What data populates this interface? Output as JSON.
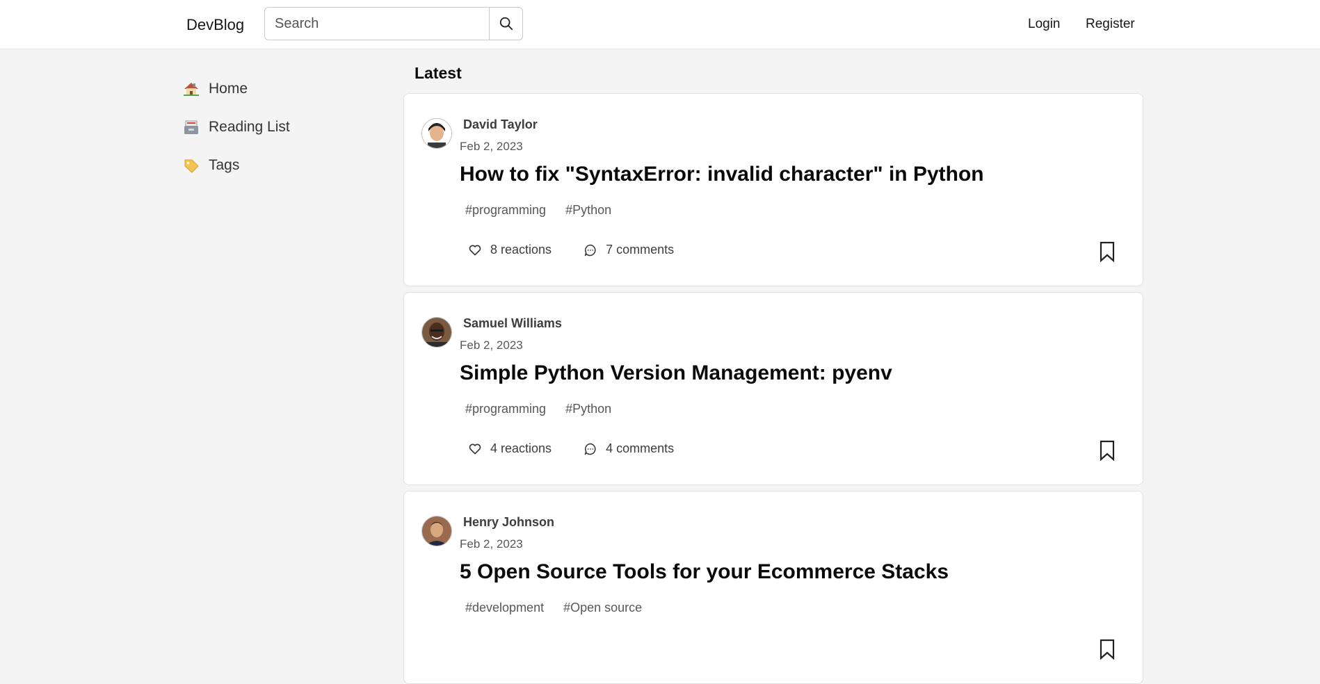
{
  "header": {
    "brand": "DevBlog",
    "search_placeholder": "Search",
    "login": "Login",
    "register": "Register"
  },
  "sidebar": {
    "items": [
      {
        "label": "Home",
        "icon": "house-icon"
      },
      {
        "label": "Reading List",
        "icon": "card-file-box-icon"
      },
      {
        "label": "Tags",
        "icon": "label-tag-icon"
      }
    ]
  },
  "feed": {
    "heading": "Latest",
    "posts": [
      {
        "author": "David Taylor",
        "date": "Feb 2, 2023",
        "title": "How to fix \"SyntaxError: invalid character\" in Python",
        "tags": [
          "#programming",
          "#Python"
        ],
        "reactions": "8 reactions",
        "comments": "7 comments"
      },
      {
        "author": "Samuel Williams",
        "date": "Feb 2, 2023",
        "title": "Simple Python Version Management: pyenv",
        "tags": [
          "#programming",
          "#Python"
        ],
        "reactions": "4 reactions",
        "comments": "4 comments"
      },
      {
        "author": "Henry Johnson",
        "date": "Feb 2, 2023",
        "title": "5 Open Source Tools for your Ecommerce Stacks",
        "tags": [
          "#development",
          "#Open source"
        ],
        "reactions": "",
        "comments": ""
      }
    ]
  }
}
